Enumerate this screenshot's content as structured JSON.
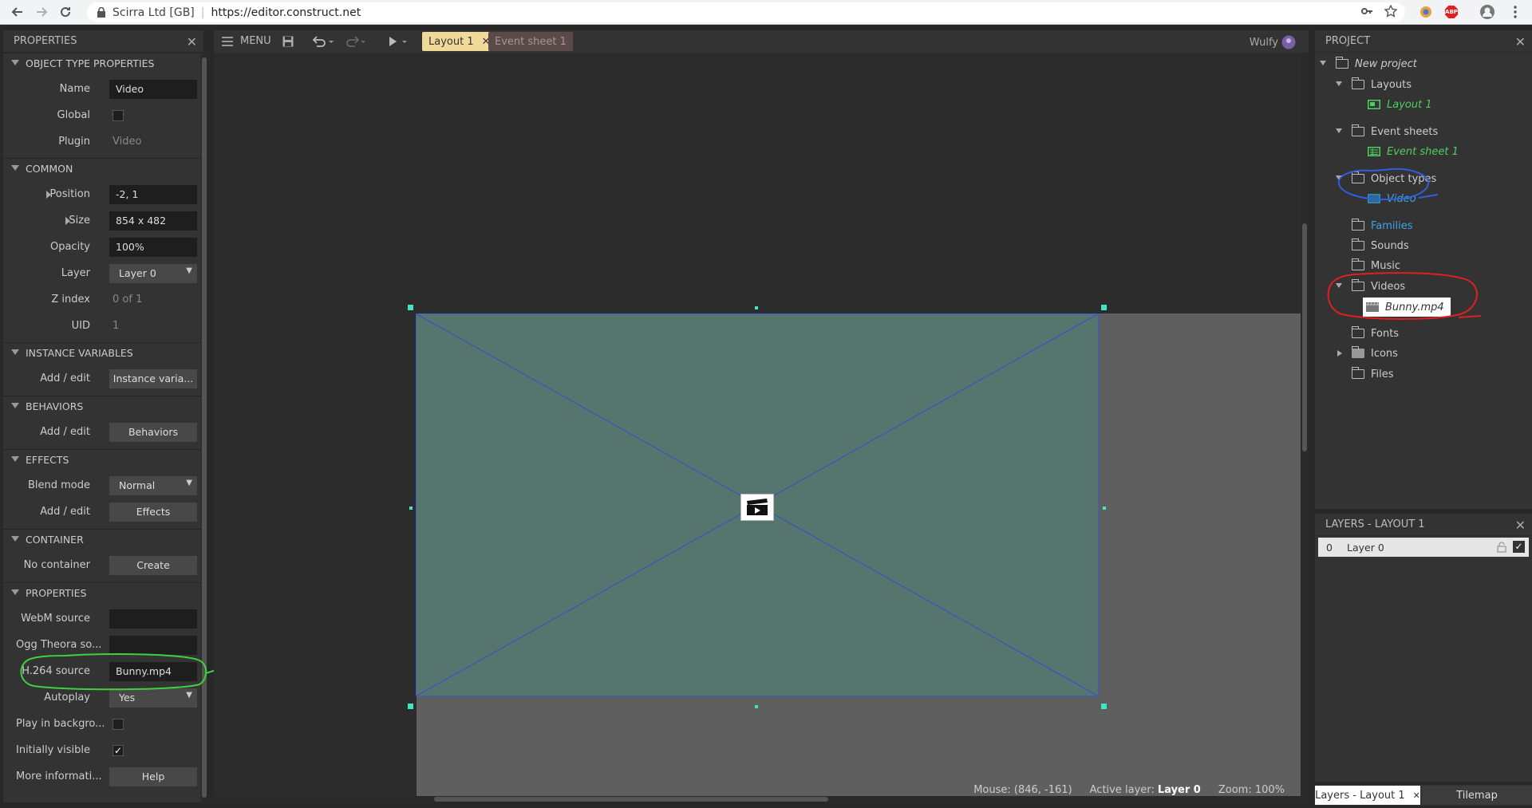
{
  "browser": {
    "org": "Scirra Ltd [GB]",
    "url": "https://editor.construct.net",
    "ext_abp": "ABP"
  },
  "props_panel": {
    "title": "PROPERTIES",
    "sections": {
      "object_type": "OBJECT TYPE PROPERTIES",
      "common": "COMMON",
      "instance_vars": "INSTANCE VARIABLES",
      "behaviors": "BEHAVIORS",
      "effects": "EFFECTS",
      "container": "CONTAINER",
      "properties": "PROPERTIES"
    },
    "name_label": "Name",
    "name_value": "Video",
    "global_label": "Global",
    "plugin_label": "Plugin",
    "plugin_value": "Video",
    "position_label": "Position",
    "position_value": "-2, 1",
    "size_label": "Size",
    "size_value": "854 x 482",
    "opacity_label": "Opacity",
    "opacity_value": "100%",
    "layer_label": "Layer",
    "layer_value": "Layer 0",
    "zindex_label": "Z index",
    "zindex_value": "0 of 1",
    "uid_label": "UID",
    "uid_value": "1",
    "iv_label": "Add / edit",
    "iv_button": "Instance varia...",
    "beh_label": "Add / edit",
    "beh_button": "Behaviors",
    "blend_label": "Blend mode",
    "blend_value": "Normal",
    "eff_label": "Add / edit",
    "eff_button": "Effects",
    "container_label": "No container",
    "container_button": "Create",
    "webm_label": "WebM source",
    "webm_value": "",
    "ogg_label": "Ogg Theora so...",
    "ogg_value": "",
    "h264_label": "H.264 source",
    "h264_value": "Bunny.mp4",
    "autoplay_label": "Autoplay",
    "autoplay_value": "Yes",
    "playbg_label": "Play in backgro...",
    "visible_label": "Initially visible",
    "more_label": "More informati...",
    "more_button": "Help"
  },
  "toolbar": {
    "menu_label": "MENU",
    "tab_layout": "Layout 1",
    "tab_events": "Event sheet 1",
    "user": "Wulfy"
  },
  "status": {
    "mouse": "Mouse: (846, -161)",
    "active_layer_label": "Active layer:",
    "active_layer": "Layer 0",
    "zoom": "Zoom: 100%"
  },
  "project": {
    "title": "PROJECT",
    "root": "New project",
    "layouts": "Layouts",
    "layout1": "Layout 1",
    "event_sheets": "Event sheets",
    "event_sheet1": "Event sheet 1",
    "object_types": "Object types",
    "video": "Video",
    "families": "Families",
    "sounds": "Sounds",
    "music": "Music",
    "videos": "Videos",
    "bunny": "Bunny.mp4",
    "fonts": "Fonts",
    "icons": "Icons",
    "files": "Files"
  },
  "layers": {
    "title": "LAYERS - LAYOUT 1",
    "row_index": "0",
    "row_name": "Layer 0",
    "tab_layers": "Layers - Layout 1",
    "tab_tilemap": "Tilemap"
  },
  "colors": {
    "accent_tab": "#f1d99a",
    "handle": "#3ee6c4",
    "video_fill": "#56756e",
    "green_tree": "#4fcf5f",
    "blue_tree": "#3aa6e6"
  }
}
